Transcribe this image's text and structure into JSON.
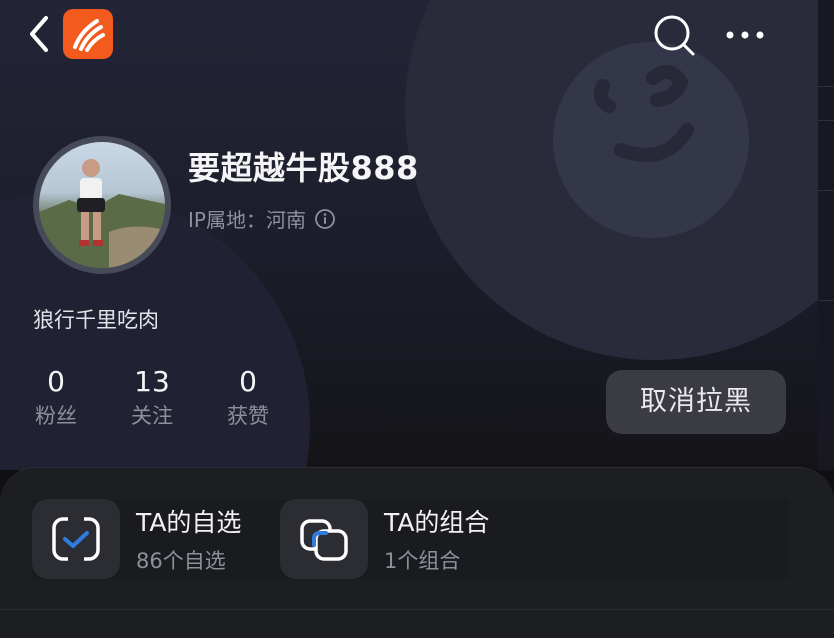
{
  "header": {
    "back_icon": "chevron-left-icon",
    "app_logo_icon": "app-logo-icon",
    "search_icon": "search-icon",
    "more_icon": "more-horizontal-icon"
  },
  "profile": {
    "username": "要超越牛股888",
    "ip_location": "IP属地：河南",
    "bio": "狼行千里吃肉"
  },
  "stats": [
    {
      "value": "0",
      "label": "粉丝"
    },
    {
      "value": "13",
      "label": "关注"
    },
    {
      "value": "0",
      "label": "获赞"
    }
  ],
  "actions": {
    "unblock_label": "取消拉黑"
  },
  "entries": [
    {
      "title": "TA的自选",
      "subtitle": "86个自选",
      "icon": "watchlist-check-icon"
    },
    {
      "title": "TA的组合",
      "subtitle": "1个组合",
      "icon": "portfolio-combo-icon"
    }
  ],
  "colors": {
    "brand_orange": "#f25a1e",
    "accent_blue": "#2f7bdf",
    "background": "#0f0f14",
    "button_bg": "#3a3b43"
  }
}
